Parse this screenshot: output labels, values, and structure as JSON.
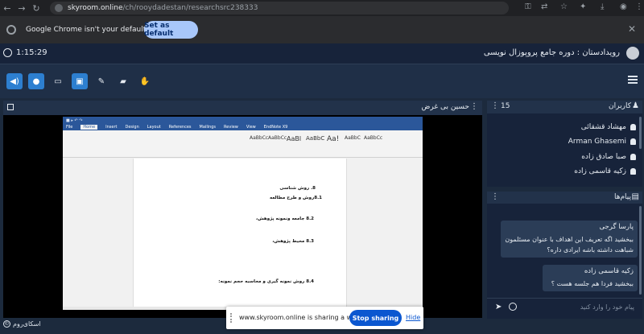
{
  "browser": {
    "url_host": "skyroom.online",
    "url_path": "/ch/rooydadestan/researchsrc238333",
    "infobar_message": "Google Chrome isn't your default browser",
    "set_default_label": "Set as default"
  },
  "header": {
    "timer": "1:15:29",
    "room_title": "رویدادستان : دوره جامع پروپوزال نویسی"
  },
  "video": {
    "presenter_name": "حسین بی غرض"
  },
  "document": {
    "lines": [
      "8.    روش شناسی",
      "8.1روش و طرح مطالعه",
      "8.2  جامعه ونمونه پژوهش،",
      "8.3  محیط پژوهش،",
      "8.4  روش نمونه گیری و محاسبه حجم نمونه:"
    ],
    "tabs": [
      "File",
      "Home",
      "Insert",
      "Design",
      "Layout",
      "References",
      "Mailings",
      "Review",
      "View",
      "EndNote X9"
    ],
    "styles": [
      "AaBbCc",
      "AaBbCc",
      "AaBl",
      "AaBbC",
      "Aa!",
      "AaBbC",
      "AaBbCc"
    ]
  },
  "share": {
    "message": "www.skyroom.online is sharing a window.",
    "stop_label": "Stop sharing",
    "hide_label": "Hide"
  },
  "footer": {
    "brand": "اسکای‌روم"
  },
  "users": {
    "title": "کاربران",
    "count": "15",
    "items": [
      "مهشاد قشقائی",
      "Arman Ghasemi",
      "صبا صادق زاده",
      "زکیه قاسمی زاده"
    ]
  },
  "chat": {
    "title": "پیام‌ها",
    "messages": [
      {
        "who": "پارسا گرجی",
        "body": "ببخشید اگه تعریف این اهداف با عنوان مسئلمون شباهت داشته باشه ایرادی داره؟"
      },
      {
        "who": "زکیه قاسمی زاده",
        "body": "ببخشید فردا هم جلسه هست ؟"
      }
    ],
    "placeholder": "پیام خود را وارد کنید"
  }
}
